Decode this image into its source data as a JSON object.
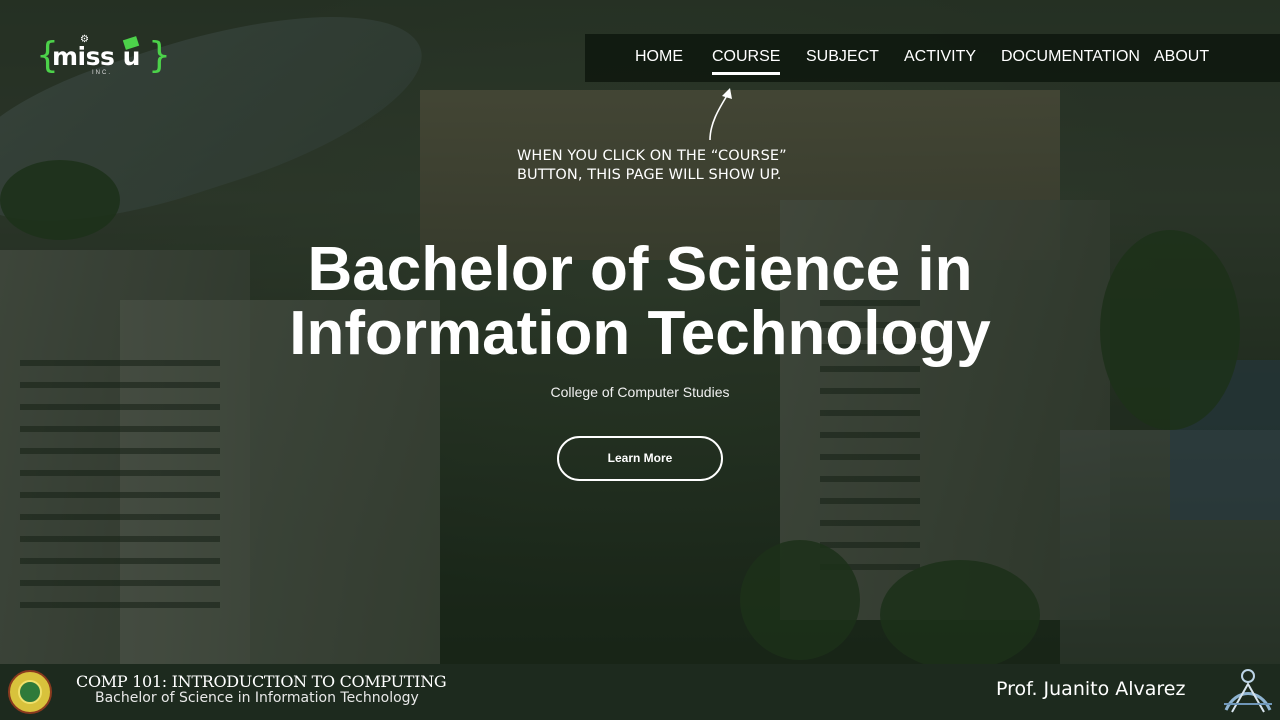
{
  "logo": {
    "brand_text": "miss u",
    "suffix": "INC."
  },
  "nav": {
    "items": [
      {
        "label": "HOME",
        "active": false
      },
      {
        "label": "COURSE",
        "active": true
      },
      {
        "label": "SUBJECT",
        "active": false
      },
      {
        "label": "ACTIVITY",
        "active": false
      },
      {
        "label": "DOCUMENTATION",
        "active": false
      },
      {
        "label": "ABOUT",
        "active": false
      }
    ]
  },
  "annotation": {
    "line1": "WHEN YOU CLICK ON THE “COURSE”",
    "line2": "BUTTON, THIS PAGE WILL SHOW UP."
  },
  "hero": {
    "title_line1": "Bachelor of Science in",
    "title_line2": "Information Technology",
    "subtitle": "College of Computer Studies",
    "button_label": "Learn More"
  },
  "footer": {
    "course_code": "COMP 101: INTRODUCTION TO COMPUTING",
    "program": "Bachelor of Science in Information Technology",
    "professor": "Prof. Juanito  Alvarez"
  },
  "colors": {
    "accent_green": "#4cd24a",
    "footer_bg": "#1d2a1e",
    "navbar_bg": "#0c140c"
  }
}
